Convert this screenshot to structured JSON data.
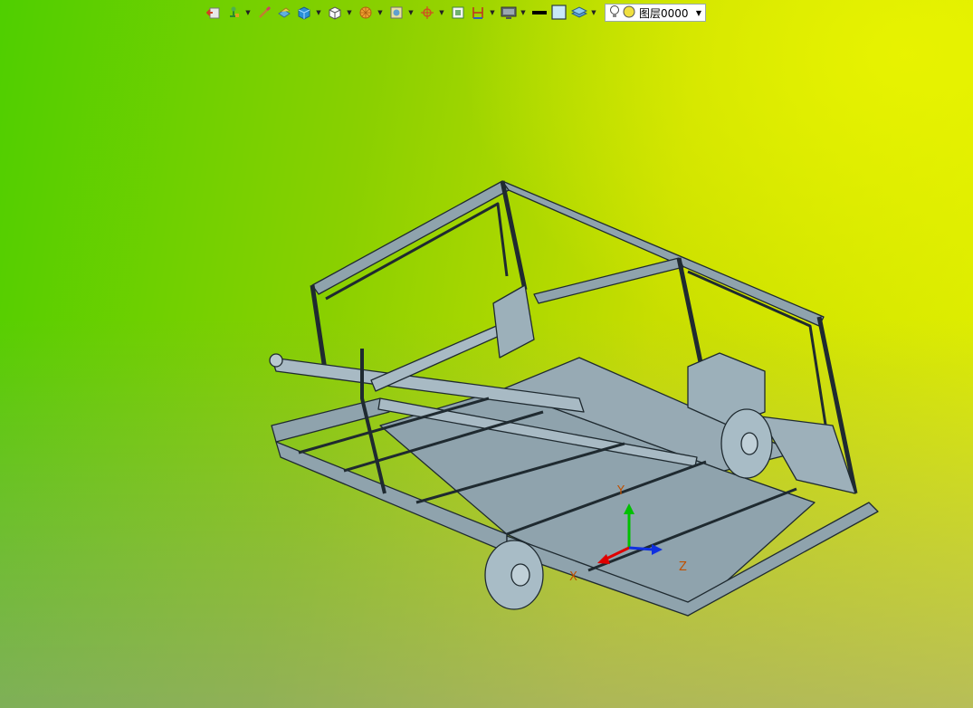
{
  "toolbar": {
    "icons": [
      "exit-icon",
      "transform-icon",
      "brush-icon",
      "solid-icon",
      "cube-icon",
      "view-cube-icon",
      "render-style-icon",
      "snap-icon",
      "section-icon",
      "fit-view-icon",
      "dimension-icon",
      "display-icon",
      "line-color-icon",
      "fill-color-icon",
      "layer-stack-icon"
    ],
    "layer": {
      "label": "图层0000",
      "bulb_icon": "light-bulb-icon",
      "color_icon": "layer-color-icon"
    }
  },
  "canvas": {
    "background_colors": [
      "#52d000",
      "#e0ee00",
      "#9aa89a"
    ],
    "model_color": "#8fa3ad",
    "model": "trailer frame assembly",
    "triad": {
      "x_label": "X",
      "y_label": "Y",
      "z_label": "Z",
      "colors": {
        "x": "#e00000",
        "y": "#00c000",
        "z": "#1030e0"
      }
    }
  }
}
